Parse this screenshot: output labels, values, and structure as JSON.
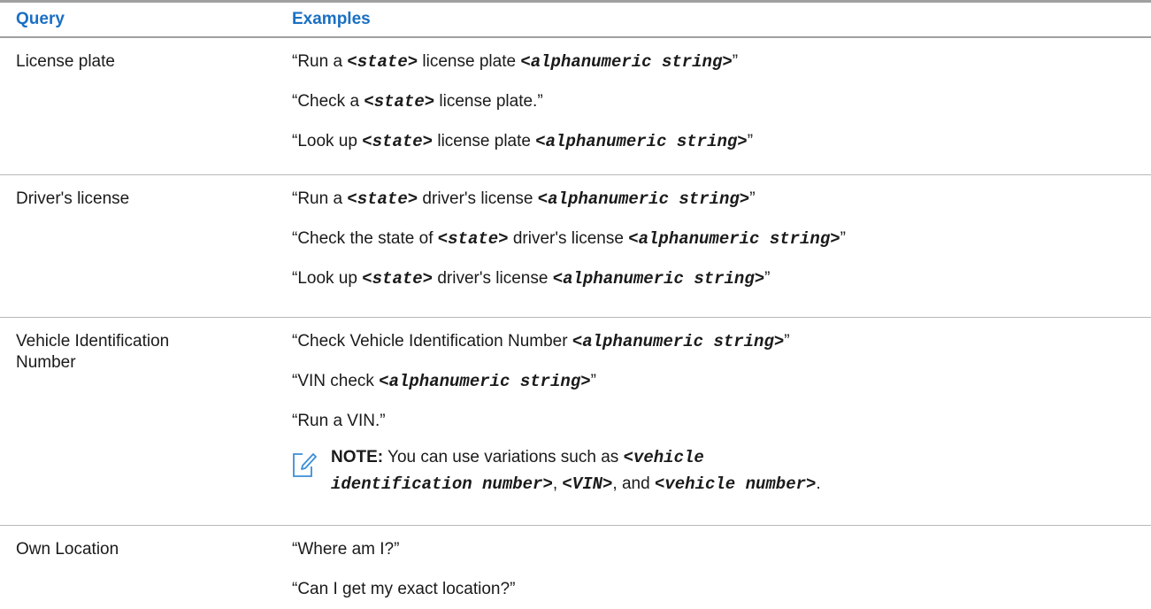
{
  "header": {
    "query_label": "Query",
    "examples_label": "Examples"
  },
  "rows": [
    {
      "query": "License plate",
      "examples": [
        {
          "pre": "“Run a ",
          "p1": "<state>",
          "mid": " license plate ",
          "p2": "<alphanumeric string>",
          "post": "”"
        },
        {
          "pre": "“Check a ",
          "p1": "<state>",
          "mid": " license plate.”"
        },
        {
          "pre": "“Look up ",
          "p1": "<state>",
          "mid": " license plate ",
          "p2": "<alphanumeric string>",
          "post": "”"
        }
      ]
    },
    {
      "query": "Driver's license",
      "examples": [
        {
          "pre": "“Run a ",
          "p1": "<state>",
          "mid": " driver's license ",
          "p2": "<alphanumeric string>",
          "post": "”"
        },
        {
          "pre": "“Check the state of ",
          "p1": "<state>",
          "mid": " driver's license ",
          "p2": "<alphanumeric string>",
          "post": "”"
        },
        {
          "pre": "“Look up ",
          "p1": "<state>",
          "mid": " driver's license ",
          "p2": "<alphanumeric string>",
          "post": "”"
        }
      ]
    },
    {
      "query_line1": "Vehicle Identification",
      "query_line2": "Number",
      "examples": [
        {
          "pre": "“Check Vehicle Identification Number ",
          "p1": "<alphanumeric string>",
          "mid": "”"
        },
        {
          "pre": "“VIN check ",
          "p1": "<alphanumeric string>",
          "mid": "”"
        },
        {
          "pre": "“Run a VIN.”"
        }
      ],
      "note": {
        "label": "NOTE:",
        "text1": " You can use variations such as ",
        "v1a": "<vehicle",
        "v1b": "identification number>",
        "sep1": ", ",
        "v2": "<VIN>",
        "sep2": ", and ",
        "v3": "<vehicle number>",
        "end": "."
      }
    },
    {
      "query": "Own Location",
      "examples": [
        {
          "pre": "“Where am I?”"
        },
        {
          "pre": "“Can I get my exact location?”"
        }
      ]
    }
  ],
  "icons": {
    "note": "pencil-note-icon"
  },
  "colors": {
    "header_text": "#1a6fc4",
    "note_icon": "#3a8fd6"
  }
}
